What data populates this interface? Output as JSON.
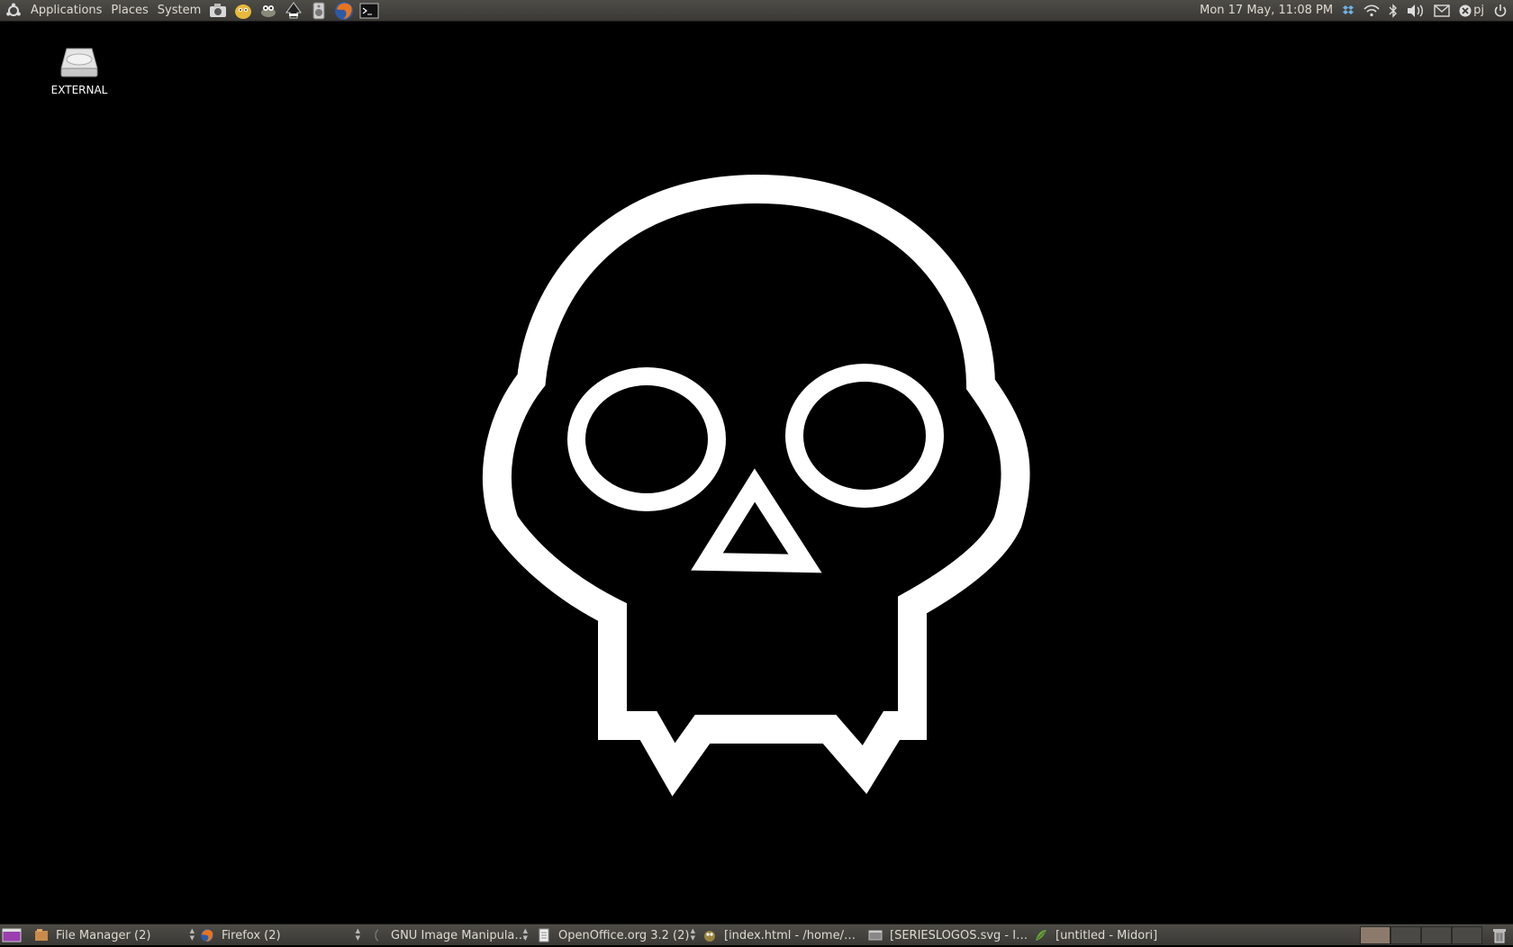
{
  "top_panel": {
    "menus": [
      "Applications",
      "Places",
      "System"
    ],
    "launchers": [
      "screenshot-icon",
      "pidgin-icon",
      "gimp-icon",
      "inkscape-icon",
      "speaker-app-icon",
      "firefox-icon",
      "terminal-icon"
    ],
    "clock": "Mon 17 May, 11:08 PM",
    "user": "pj"
  },
  "desktop": {
    "icons": [
      {
        "label": "EXTERNAL",
        "icon": "drive-icon"
      }
    ]
  },
  "taskbar": {
    "tasks": [
      {
        "label": "File Manager (2)"
      },
      {
        "label": "Firefox (2)"
      },
      {
        "label": "GNU Image Manipulati..."
      },
      {
        "label": "OpenOffice.org 3.2 (2)"
      },
      {
        "label": "[index.html - /home/pj/..."
      },
      {
        "label": "[SERIESLOGOS.svg - In..."
      },
      {
        "label": "[untitled - Midori]"
      }
    ]
  },
  "colors": {
    "panel": "#3f3e3a",
    "background": "#000000",
    "skull": "#ffffff"
  }
}
